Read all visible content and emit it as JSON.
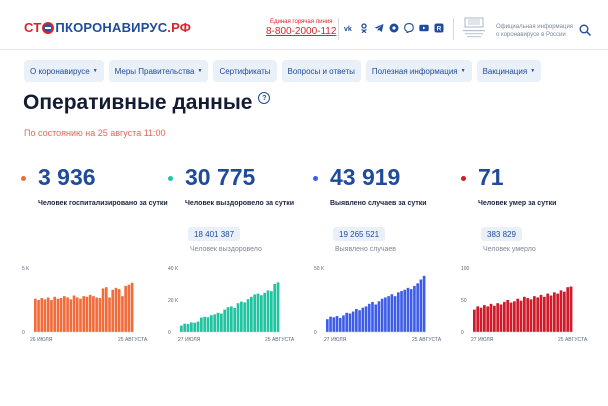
{
  "header": {
    "logo": {
      "part1": "СТ",
      "part2": "ПКОРОНАВИРУС",
      "part3": ".РФ"
    },
    "hotline_label": "Единая горячая линия",
    "hotline_phone": "8-800-2000-112",
    "socials": [
      "vk-icon",
      "ok-icon",
      "telegram-icon",
      "odnoklassniki-icon",
      "viber-icon",
      "youtube-icon",
      "rutube-icon"
    ],
    "info_text": "Официальная информация о коронавирусе в России"
  },
  "nav": [
    {
      "label": "О коронавирусе",
      "caret": true
    },
    {
      "label": "Меры Правительства",
      "caret": true
    },
    {
      "label": "Сертификаты",
      "caret": false
    },
    {
      "label": "Вопросы и ответы",
      "caret": false
    },
    {
      "label": "Полезная информация",
      "caret": true
    },
    {
      "label": "Вакцинация",
      "caret": true
    }
  ],
  "page": {
    "title": "Оперативные данные",
    "help": "?",
    "as_of": "По состоянию на 25 августа 11:00"
  },
  "stats": [
    {
      "number": "3 936",
      "label": "Человек госпитализировано за сутки",
      "total": "",
      "total_label": "",
      "color": "#f26b3a"
    },
    {
      "number": "30 775",
      "label": "Человек выздоровело за сутки",
      "total": "18 401 387",
      "total_label": "Человек выздоровело",
      "color": "#20c4a0"
    },
    {
      "number": "43 919",
      "label": "Выявлено случаев за сутки",
      "total": "19 265 521",
      "total_label": "Выявлено случаев",
      "color": "#3d5de8"
    },
    {
      "number": "71",
      "label": "Человек умер за сутки",
      "total": "383 829",
      "total_label": "Человек умерло",
      "color": "#d11a2a"
    }
  ],
  "chart_data": [
    {
      "type": "bar",
      "yticks": [
        "5 К",
        "0"
      ],
      "ylim": [
        0,
        5000
      ],
      "x_start": "26 ИЮЛЯ",
      "x_end": "25 АВГУСТА",
      "color": "#f26b3a",
      "values": [
        2600,
        2500,
        2650,
        2550,
        2700,
        2500,
        2750,
        2600,
        2650,
        2800,
        2700,
        2550,
        2850,
        2700,
        2600,
        2800,
        2750,
        2900,
        2800,
        2700,
        2650,
        3400,
        3500,
        2700,
        3300,
        3450,
        3350,
        2800,
        3600,
        3700,
        3850
      ]
    },
    {
      "type": "bar",
      "yticks": [
        "40 К",
        "20 К",
        "0"
      ],
      "ylim": [
        0,
        40000
      ],
      "x_start": "27 ИЮЛЯ",
      "x_end": "25 АВГУСТА",
      "color": "#20c4a0",
      "values": [
        4000,
        5200,
        5000,
        6000,
        5800,
        6500,
        9000,
        9500,
        9200,
        10500,
        11000,
        12000,
        11500,
        14000,
        15500,
        16000,
        15000,
        18000,
        19000,
        18500,
        20500,
        22000,
        23500,
        24000,
        23000,
        24500,
        26000,
        25500,
        30000,
        31000
      ]
    },
    {
      "type": "bar",
      "yticks": [
        "50 К",
        "0"
      ],
      "ylim": [
        0,
        50000
      ],
      "x_start": "27 ИЮЛЯ",
      "x_end": "25 АВГУСТА",
      "color": "#3d5de8",
      "values": [
        10000,
        12000,
        11500,
        12500,
        11000,
        13000,
        15000,
        14500,
        16000,
        18000,
        17000,
        19000,
        20000,
        22000,
        23500,
        21500,
        24000,
        26000,
        27000,
        28000,
        29500,
        28000,
        31000,
        32000,
        33000,
        34500,
        33500,
        36000,
        38000,
        41000,
        43900
      ]
    },
    {
      "type": "bar",
      "yticks": [
        "100",
        "50",
        "0"
      ],
      "ylim": [
        0,
        100
      ],
      "x_start": "27 ИЮЛЯ",
      "x_end": "25 АВГУСТА",
      "color": "#d11a2a",
      "values": [
        35,
        40,
        38,
        42,
        40,
        44,
        41,
        45,
        43,
        47,
        50,
        46,
        48,
        52,
        49,
        55,
        53,
        51,
        56,
        54,
        58,
        55,
        60,
        57,
        62,
        60,
        65,
        63,
        70,
        71
      ]
    }
  ]
}
